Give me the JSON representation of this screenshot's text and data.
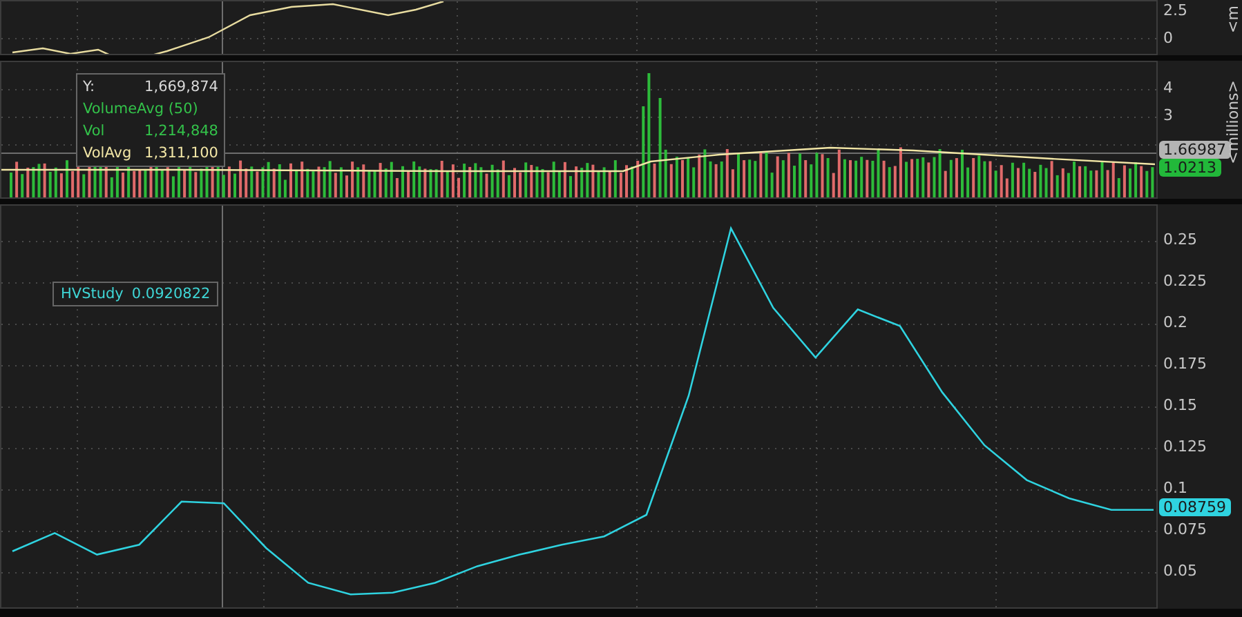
{
  "top_panel": {
    "axis_labels": [
      "2.5",
      "0"
    ],
    "axis_unit": "<m"
  },
  "volume_panel": {
    "axis_labels": [
      "4",
      "3"
    ],
    "axis_unit": "<millions>",
    "tooltip": [
      {
        "label": "Y:",
        "value": "1,669,874",
        "color": "#d8d8d8"
      },
      {
        "label": "VolumeAvg (50)",
        "color": "#33c24a"
      },
      {
        "label": "Vol",
        "value": "1,214,848",
        "color": "#33c24a"
      },
      {
        "label": "VolAvg",
        "value": "1,311,100",
        "color": "#f2e6a6"
      }
    ],
    "price_labels": [
      {
        "text": "1.66987",
        "color": "#b4b4b4"
      },
      {
        "text": "1.0213",
        "color": "#22b83a"
      }
    ]
  },
  "hv_panel": {
    "legend": {
      "value": "0.0920822"
    },
    "last_value": "0.08759",
    "chart_data": {
      "type": "line",
      "categories": [
        null,
        null,
        null,
        null,
        null,
        null,
        null,
        null,
        null,
        null,
        null,
        null,
        null,
        null,
        null,
        null,
        null,
        null,
        null,
        null,
        null,
        null,
        null,
        null,
        null,
        null,
        null,
        null
      ],
      "series": [
        {
          "name": "HVStudy",
          "color": "#2fd3e0",
          "values": [
            0.063,
            0.074,
            0.061,
            0.067,
            0.093,
            0.092,
            0.065,
            0.044,
            0.037,
            0.038,
            0.044,
            0.054,
            0.061,
            0.067,
            0.072,
            0.085,
            0.157,
            0.258,
            0.21,
            0.18,
            0.209,
            0.199,
            0.159,
            0.127,
            0.106,
            0.095,
            0.088,
            0.088
          ]
        }
      ],
      "grid": true,
      "ylim": [
        0.0275,
        0.2717
      ],
      "yticks": [
        {
          "value": 0.05,
          "label": "0.05"
        },
        {
          "value": 0.075,
          "label": "0.075"
        },
        {
          "value": 0.1,
          "label": "0.1"
        },
        {
          "value": 0.125,
          "label": "0.125"
        },
        {
          "value": 0.15,
          "label": "0.15"
        },
        {
          "value": 0.175,
          "label": "0.175"
        },
        {
          "value": 0.2,
          "label": "0.2"
        },
        {
          "value": 0.225,
          "label": "0.225"
        },
        {
          "value": 0.25,
          "label": "0.25"
        }
      ]
    }
  }
}
